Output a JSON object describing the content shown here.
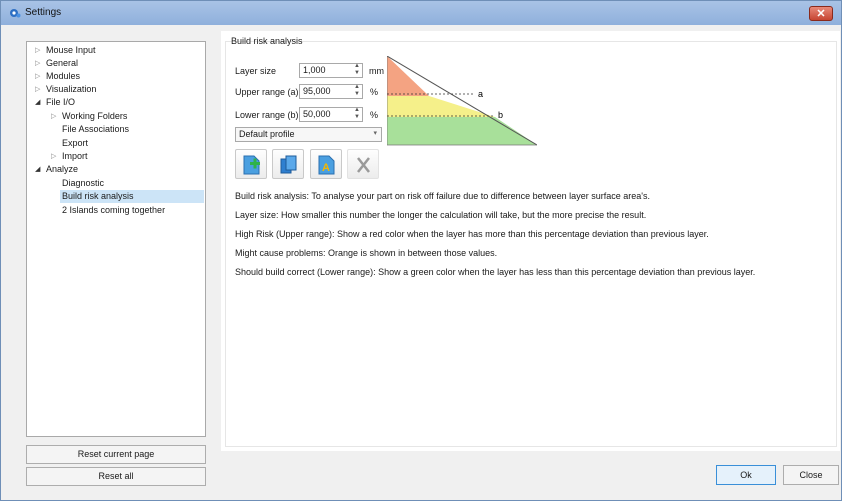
{
  "window": {
    "title": "Settings"
  },
  "sidebar": {
    "items": [
      {
        "label": "Mouse Input"
      },
      {
        "label": "General"
      },
      {
        "label": "Modules"
      },
      {
        "label": "Visualization"
      },
      {
        "label": "File I/O"
      },
      {
        "label": "Working Folders"
      },
      {
        "label": "File Associations"
      },
      {
        "label": "Export"
      },
      {
        "label": "Import"
      },
      {
        "label": "Analyze"
      },
      {
        "label": "Diagnostic"
      },
      {
        "label": "Build risk analysis"
      },
      {
        "label": "2 Islands coming together"
      }
    ],
    "selected": "Build risk analysis",
    "reset_page_label": "Reset current page",
    "reset_all_label": "Reset all"
  },
  "content": {
    "group_title": "Build risk analysis",
    "fields": {
      "layer_size": {
        "label": "Layer size",
        "value": "1,000",
        "unit": "mm"
      },
      "upper_range": {
        "label": "Upper range (a)",
        "value": "95,000",
        "unit": "%"
      },
      "lower_range": {
        "label": "Lower range (b)",
        "value": "50,000",
        "unit": "%"
      }
    },
    "profile": {
      "selected": "Default profile"
    },
    "diagram": {
      "marker_a": "a",
      "marker_b": "b",
      "colors": {
        "high": "#f4a382",
        "mid": "#f5f08a",
        "low": "#a8e09a"
      }
    },
    "descriptions": [
      "Build risk analysis: To analyse your part on risk off failure due to difference between layer surface area's.",
      "Layer size: How smaller this number the longer the calculation will take, but the more precise the result.",
      "High Risk (Upper range): Show a red color when the layer has more than this percentage deviation than previous layer.",
      "Might cause problems: Orange is shown in between those values.",
      "Should build correct (Lower range): Show a green color when the layer has less than this percentage deviation than previous layer."
    ]
  },
  "footer": {
    "ok_label": "Ok",
    "close_label": "Close"
  },
  "icons": [
    "settings-app-icon",
    "close-icon",
    "tree-expand-icon",
    "tree-collapse-icon",
    "add-profile-icon",
    "copy-profile-icon",
    "rename-profile-icon",
    "delete-profile-icon",
    "dropdown-arrow-icon",
    "spinner-arrows-icon"
  ]
}
